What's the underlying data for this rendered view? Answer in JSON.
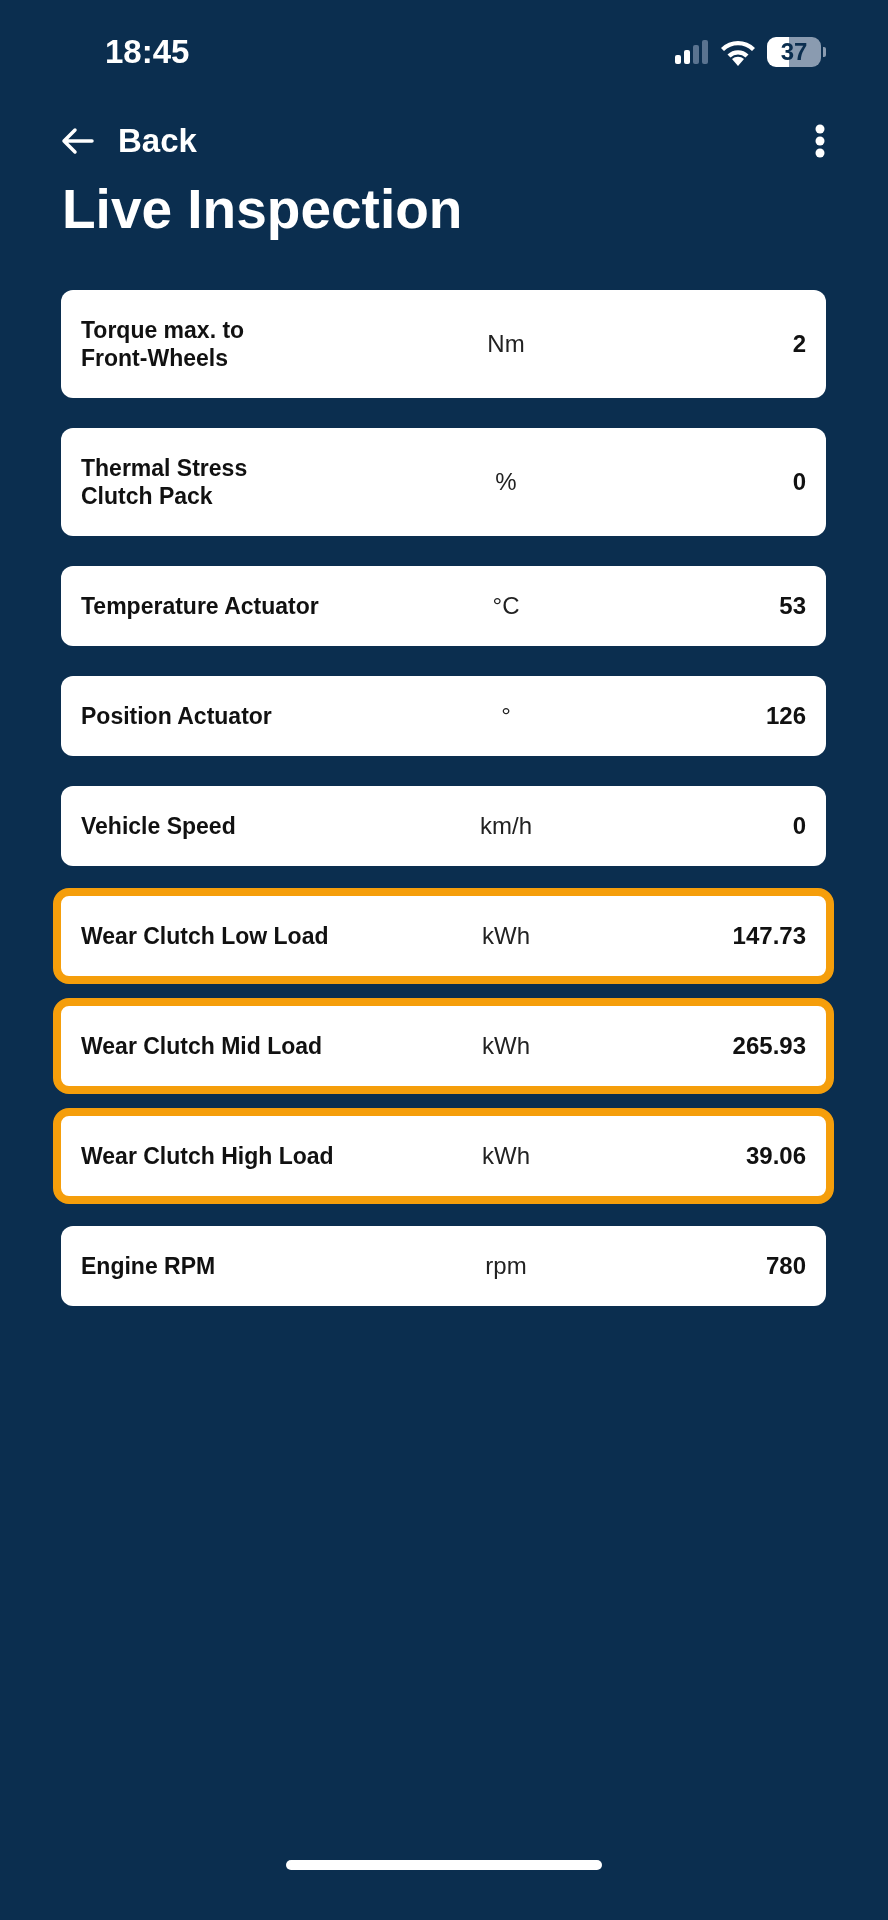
{
  "status_bar": {
    "time": "18:45",
    "battery": "37"
  },
  "nav": {
    "back_label": "Back"
  },
  "title": "Live Inspection",
  "rows": [
    {
      "label": "Torque max. to\nFront-Wheels",
      "unit": "Nm",
      "value": "2",
      "highlighted": false
    },
    {
      "label": "Thermal Stress\nClutch Pack",
      "unit": "%",
      "value": "0",
      "highlighted": false
    },
    {
      "label": "Temperature Actuator",
      "unit": "°C",
      "value": "53",
      "highlighted": false
    },
    {
      "label": "Position Actuator",
      "unit": "°",
      "value": "126",
      "highlighted": false
    },
    {
      "label": "Vehicle Speed",
      "unit": "km/h",
      "value": "0",
      "highlighted": false
    },
    {
      "label": "Wear Clutch Low Load",
      "unit": "kWh",
      "value": "147.73",
      "highlighted": true
    },
    {
      "label": "Wear Clutch Mid Load",
      "unit": "kWh",
      "value": "265.93",
      "highlighted": true
    },
    {
      "label": "Wear Clutch High Load",
      "unit": "kWh",
      "value": "39.06",
      "highlighted": true
    },
    {
      "label": "Engine RPM",
      "unit": "rpm",
      "value": "780",
      "highlighted": false
    }
  ]
}
